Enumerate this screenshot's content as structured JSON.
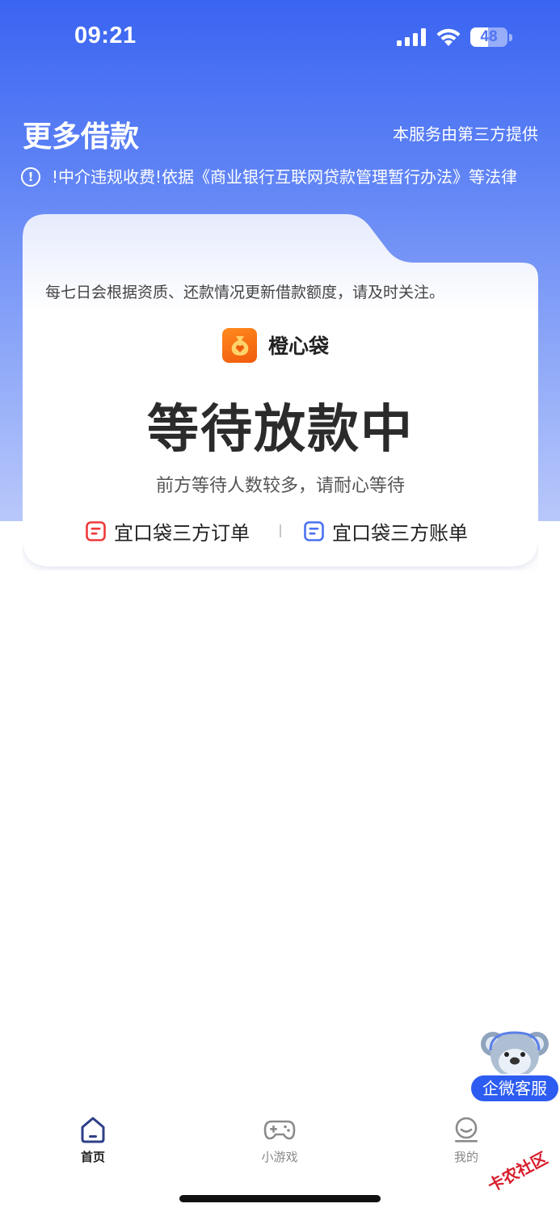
{
  "status_bar": {
    "time": "09:21",
    "battery_level": 48,
    "battery_text": "48"
  },
  "header": {
    "title": "更多借款",
    "provider_note": "本服务由第三方提供",
    "notice_text": "!中介违规收费!依据《商业银行互联网贷款管理暂行办法》等法律"
  },
  "card": {
    "tip": "每七日会根据资质、还款情况更新借款额度，请及时关注。",
    "brand_name": "橙心袋",
    "status_title": "等待放款中",
    "status_subtitle": "前方等待人数较多，请耐心等待",
    "links": {
      "order_label": "宜口袋三方订单",
      "bill_label": "宜口袋三方账单"
    }
  },
  "customer_service": {
    "label": "企微客服"
  },
  "tabbar": {
    "home": "首页",
    "games": "小游戏",
    "mine": "我的"
  },
  "watermark": {
    "text": "卡农社区"
  },
  "colors": {
    "accent_blue": "#3a64f2",
    "brand_orange": "#f26b12",
    "order_icon_red": "#ee3a3a",
    "bill_icon_blue": "#4a72f0"
  }
}
